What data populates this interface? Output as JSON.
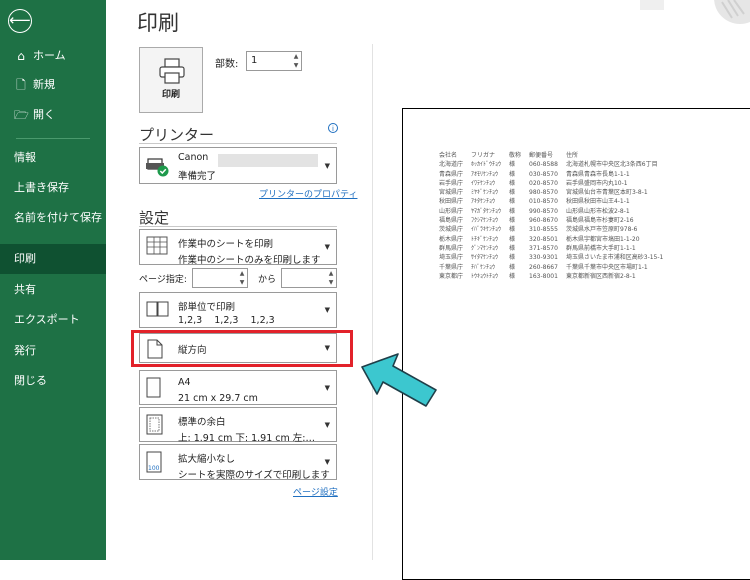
{
  "sidebar": {
    "back": "⟵",
    "items": [
      {
        "label": "ホーム",
        "icon": "home-icon"
      },
      {
        "label": "新規",
        "icon": "new-file-icon"
      },
      {
        "label": "開く",
        "icon": "open-folder-icon"
      },
      {
        "label": "情報"
      },
      {
        "label": "上書き保存"
      },
      {
        "label": "名前を付けて保存"
      },
      {
        "label": "印刷"
      },
      {
        "label": "共有"
      },
      {
        "label": "エクスポート"
      },
      {
        "label": "発行"
      },
      {
        "label": "閉じる"
      }
    ],
    "active": "印刷"
  },
  "main": {
    "title": "印刷",
    "print_button": "印刷",
    "copies_label": "部数:",
    "copies_value": "1",
    "printer_heading": "プリンター",
    "printer_name": "Canon",
    "printer_status": "準備完了",
    "printer_properties_link": "プリンターのプロパティ",
    "settings_heading": "設定",
    "print_what": {
      "line1": "作業中のシートを印刷",
      "line2": "作業中のシートのみを印刷します"
    },
    "pages_label": "ページ指定:",
    "pages_to": "から",
    "collate": {
      "line1": "部単位で印刷",
      "line2": "1,2,3    1,2,3    1,2,3"
    },
    "orientation": "縦方向",
    "paper": {
      "line1": "A4",
      "line2": "21 cm x 29.7 cm"
    },
    "margins": {
      "line1": "標準の余白",
      "line2": "上: 1.91 cm 下: 1.91 cm 左:…"
    },
    "scaling": {
      "line1": "拡大縮小なし",
      "line2": "シートを実際のサイズで印刷します"
    },
    "scaling_icon_text": "100",
    "page_setup_link": "ページ設定"
  },
  "preview": {
    "headers": [
      "会社名",
      "フリガナ",
      "敬称",
      "郵便番号",
      "住所"
    ],
    "rows": [
      [
        "北海道庁",
        "ﾎｯｶｲﾄﾞｳﾁｮｳ",
        "様",
        "060-8588",
        "北海道札幌市中央区北3条西6丁目"
      ],
      [
        "青森県庁",
        "ｱｵﾓﾘｹﾝﾁｮｳ",
        "様",
        "030-8570",
        "青森県青森市長島1-1-1"
      ],
      [
        "岩手県庁",
        "ｲﾜﾃｹﾝﾁｮｳ",
        "様",
        "020-8570",
        "岩手県盛岡市内丸10-1"
      ],
      [
        "宮城県庁",
        "ﾐﾔｷﾞｹﾝﾁｮｳ",
        "様",
        "980-8570",
        "宮城県仙台市青葉区本町3-8-1"
      ],
      [
        "秋田県庁",
        "ｱｷﾀｹﾝﾁｮｳ",
        "様",
        "010-8570",
        "秋田県秋田市山王4-1-1"
      ],
      [
        "山形県庁",
        "ﾔﾏｶﾞﾀｹﾝﾁｮｳ",
        "様",
        "990-8570",
        "山形県山形市松波2-8-1"
      ],
      [
        "福島県庁",
        "ﾌｸｼﾏｹﾝﾁｮｳ",
        "様",
        "960-8670",
        "福島県福島市杉妻町2-16"
      ],
      [
        "茨城県庁",
        "ｲﾊﾞﾗｷｹﾝﾁｮｳ",
        "様",
        "310-8555",
        "茨城県水戸市笠原町978-6"
      ],
      [
        "栃木県庁",
        "ﾄﾁｷﾞｹﾝﾁｮｳ",
        "様",
        "320-8501",
        "栃木県宇都宮市塙田1-1-20"
      ],
      [
        "群馬県庁",
        "ｸﾞﾝﾏｹﾝﾁｮｳ",
        "様",
        "371-8570",
        "群馬県前橋市大手町1-1-1"
      ],
      [
        "埼玉県庁",
        "ｻｲﾀﾏｹﾝﾁｮｳ",
        "様",
        "330-9301",
        "埼玉県さいたま市浦和区高砂3-15-1"
      ],
      [
        "千葉県庁",
        "ﾁﾊﾞｹﾝﾁｮｳ",
        "様",
        "260-8667",
        "千葉県千葉市中央区市場町1-1"
      ],
      [
        "東京都庁",
        "ﾄｳｷｮｳﾄﾁｮｳ",
        "様",
        "163-8001",
        "東京都新宿区西新宿2-8-1"
      ]
    ]
  },
  "colors": {
    "sidebar": "#1e7145",
    "active": "#0f5131",
    "highlight": "#e2222a",
    "arrow": "#3cc7cf",
    "link": "#1f6fc0"
  }
}
